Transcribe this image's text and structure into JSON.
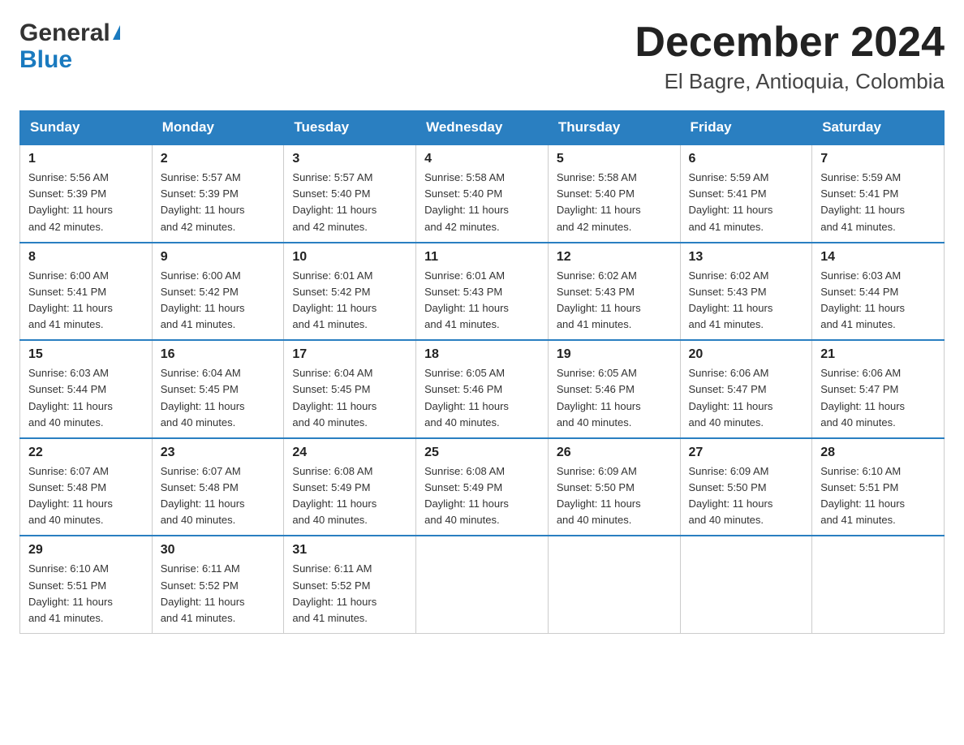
{
  "logo": {
    "general": "General",
    "blue": "Blue",
    "triangle": "▶"
  },
  "title": "December 2024",
  "location": "El Bagre, Antioquia, Colombia",
  "days_of_week": [
    "Sunday",
    "Monday",
    "Tuesday",
    "Wednesday",
    "Thursday",
    "Friday",
    "Saturday"
  ],
  "weeks": [
    [
      {
        "day": "1",
        "sunrise": "5:56 AM",
        "sunset": "5:39 PM",
        "daylight": "11 hours and 42 minutes."
      },
      {
        "day": "2",
        "sunrise": "5:57 AM",
        "sunset": "5:39 PM",
        "daylight": "11 hours and 42 minutes."
      },
      {
        "day": "3",
        "sunrise": "5:57 AM",
        "sunset": "5:40 PM",
        "daylight": "11 hours and 42 minutes."
      },
      {
        "day": "4",
        "sunrise": "5:58 AM",
        "sunset": "5:40 PM",
        "daylight": "11 hours and 42 minutes."
      },
      {
        "day": "5",
        "sunrise": "5:58 AM",
        "sunset": "5:40 PM",
        "daylight": "11 hours and 42 minutes."
      },
      {
        "day": "6",
        "sunrise": "5:59 AM",
        "sunset": "5:41 PM",
        "daylight": "11 hours and 41 minutes."
      },
      {
        "day": "7",
        "sunrise": "5:59 AM",
        "sunset": "5:41 PM",
        "daylight": "11 hours and 41 minutes."
      }
    ],
    [
      {
        "day": "8",
        "sunrise": "6:00 AM",
        "sunset": "5:41 PM",
        "daylight": "11 hours and 41 minutes."
      },
      {
        "day": "9",
        "sunrise": "6:00 AM",
        "sunset": "5:42 PM",
        "daylight": "11 hours and 41 minutes."
      },
      {
        "day": "10",
        "sunrise": "6:01 AM",
        "sunset": "5:42 PM",
        "daylight": "11 hours and 41 minutes."
      },
      {
        "day": "11",
        "sunrise": "6:01 AM",
        "sunset": "5:43 PM",
        "daylight": "11 hours and 41 minutes."
      },
      {
        "day": "12",
        "sunrise": "6:02 AM",
        "sunset": "5:43 PM",
        "daylight": "11 hours and 41 minutes."
      },
      {
        "day": "13",
        "sunrise": "6:02 AM",
        "sunset": "5:43 PM",
        "daylight": "11 hours and 41 minutes."
      },
      {
        "day": "14",
        "sunrise": "6:03 AM",
        "sunset": "5:44 PM",
        "daylight": "11 hours and 41 minutes."
      }
    ],
    [
      {
        "day": "15",
        "sunrise": "6:03 AM",
        "sunset": "5:44 PM",
        "daylight": "11 hours and 40 minutes."
      },
      {
        "day": "16",
        "sunrise": "6:04 AM",
        "sunset": "5:45 PM",
        "daylight": "11 hours and 40 minutes."
      },
      {
        "day": "17",
        "sunrise": "6:04 AM",
        "sunset": "5:45 PM",
        "daylight": "11 hours and 40 minutes."
      },
      {
        "day": "18",
        "sunrise": "6:05 AM",
        "sunset": "5:46 PM",
        "daylight": "11 hours and 40 minutes."
      },
      {
        "day": "19",
        "sunrise": "6:05 AM",
        "sunset": "5:46 PM",
        "daylight": "11 hours and 40 minutes."
      },
      {
        "day": "20",
        "sunrise": "6:06 AM",
        "sunset": "5:47 PM",
        "daylight": "11 hours and 40 minutes."
      },
      {
        "day": "21",
        "sunrise": "6:06 AM",
        "sunset": "5:47 PM",
        "daylight": "11 hours and 40 minutes."
      }
    ],
    [
      {
        "day": "22",
        "sunrise": "6:07 AM",
        "sunset": "5:48 PM",
        "daylight": "11 hours and 40 minutes."
      },
      {
        "day": "23",
        "sunrise": "6:07 AM",
        "sunset": "5:48 PM",
        "daylight": "11 hours and 40 minutes."
      },
      {
        "day": "24",
        "sunrise": "6:08 AM",
        "sunset": "5:49 PM",
        "daylight": "11 hours and 40 minutes."
      },
      {
        "day": "25",
        "sunrise": "6:08 AM",
        "sunset": "5:49 PM",
        "daylight": "11 hours and 40 minutes."
      },
      {
        "day": "26",
        "sunrise": "6:09 AM",
        "sunset": "5:50 PM",
        "daylight": "11 hours and 40 minutes."
      },
      {
        "day": "27",
        "sunrise": "6:09 AM",
        "sunset": "5:50 PM",
        "daylight": "11 hours and 40 minutes."
      },
      {
        "day": "28",
        "sunrise": "6:10 AM",
        "sunset": "5:51 PM",
        "daylight": "11 hours and 41 minutes."
      }
    ],
    [
      {
        "day": "29",
        "sunrise": "6:10 AM",
        "sunset": "5:51 PM",
        "daylight": "11 hours and 41 minutes."
      },
      {
        "day": "30",
        "sunrise": "6:11 AM",
        "sunset": "5:52 PM",
        "daylight": "11 hours and 41 minutes."
      },
      {
        "day": "31",
        "sunrise": "6:11 AM",
        "sunset": "5:52 PM",
        "daylight": "11 hours and 41 minutes."
      },
      null,
      null,
      null,
      null
    ]
  ],
  "labels": {
    "sunrise": "Sunrise:",
    "sunset": "Sunset:",
    "daylight": "Daylight:"
  }
}
